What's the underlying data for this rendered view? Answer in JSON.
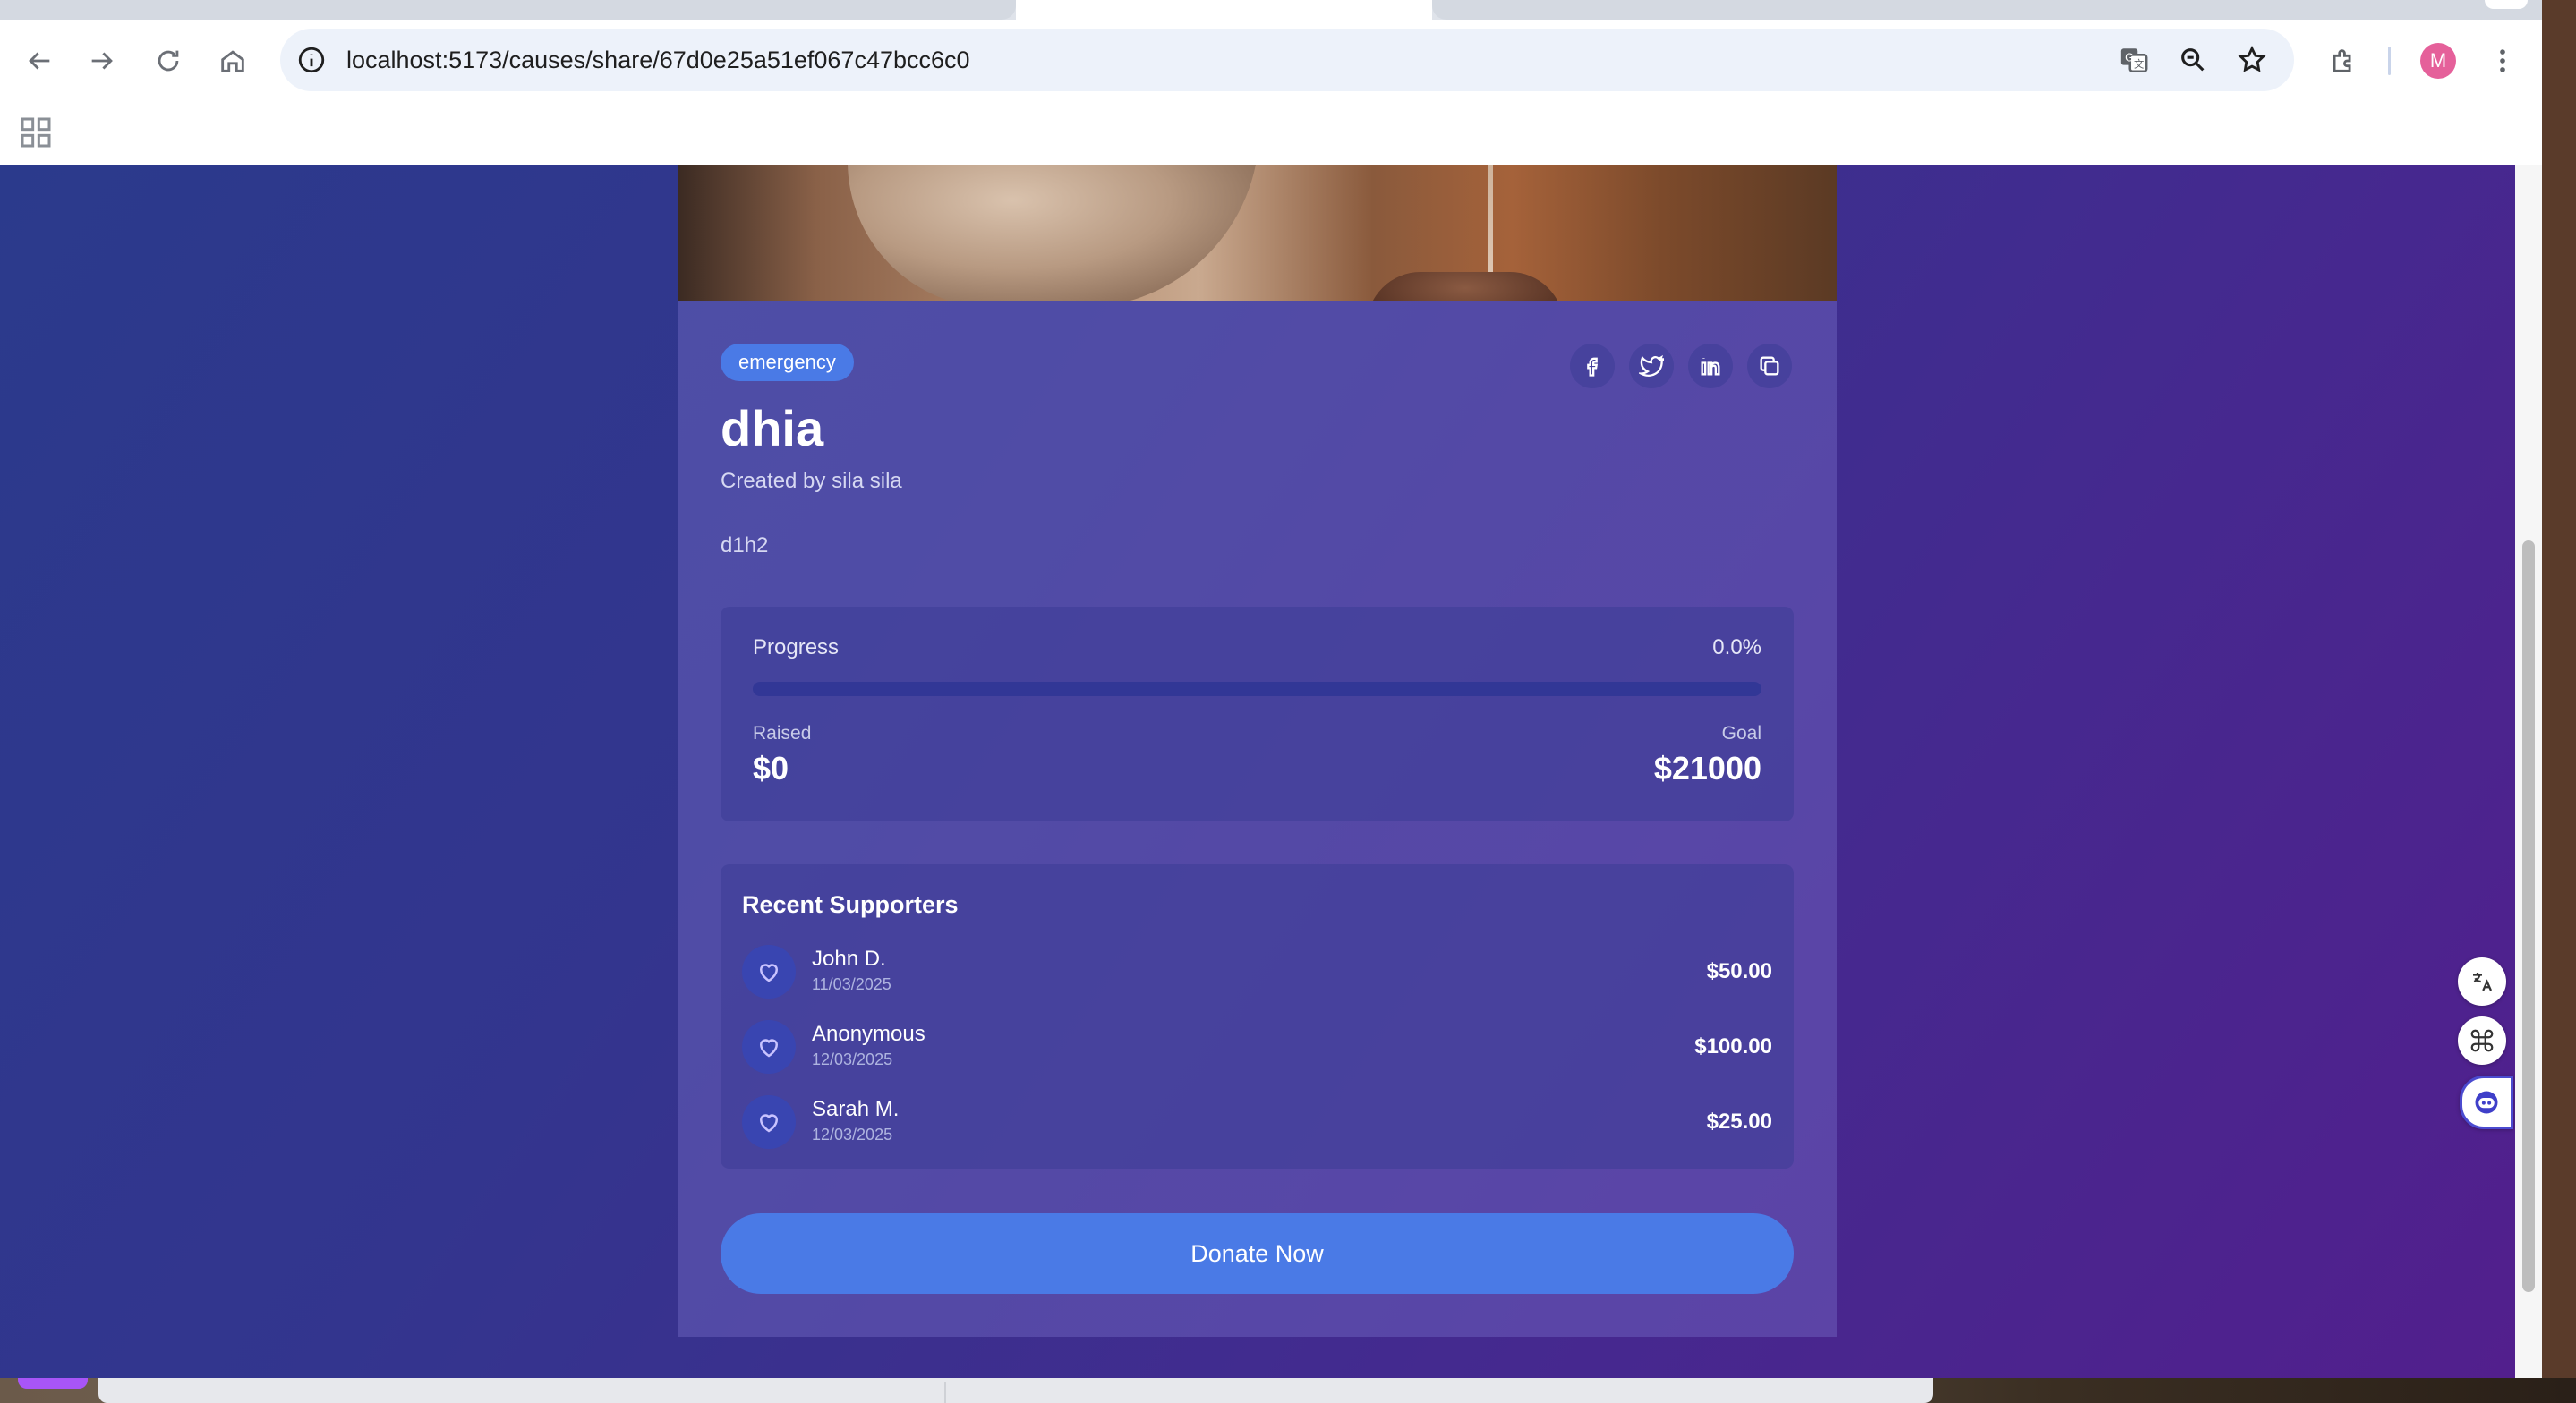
{
  "browser": {
    "url": "localhost:5173/causes/share/67d0e25a51ef067c47bcc6c0",
    "profile_initial": "M"
  },
  "cause": {
    "category": "emergency",
    "title": "dhia",
    "creator": "Created by sila sila",
    "description": "d1h2"
  },
  "progress": {
    "label": "Progress",
    "percent_text": "0.0%",
    "fraction": 0.0,
    "raised_label": "Raised",
    "raised_value": "$0",
    "goal_label": "Goal",
    "goal_value": "$21000"
  },
  "supporters": {
    "heading": "Recent Supporters",
    "items": [
      {
        "name": "John D.",
        "date": "11/03/2025",
        "amount": "$50.00"
      },
      {
        "name": "Anonymous",
        "date": "12/03/2025",
        "amount": "$100.00"
      },
      {
        "name": "Sarah M.",
        "date": "12/03/2025",
        "amount": "$25.00"
      }
    ]
  },
  "actions": {
    "donate_label": "Donate Now"
  },
  "colors": {
    "accent": "#4a7ae6",
    "avatar": "#e5609a"
  },
  "icons": {
    "share": [
      "facebook-icon",
      "twitter-icon",
      "linkedin-icon",
      "copy-icon"
    ],
    "side_tools": [
      "translate-icon",
      "command-icon",
      "assistant-icon"
    ]
  }
}
